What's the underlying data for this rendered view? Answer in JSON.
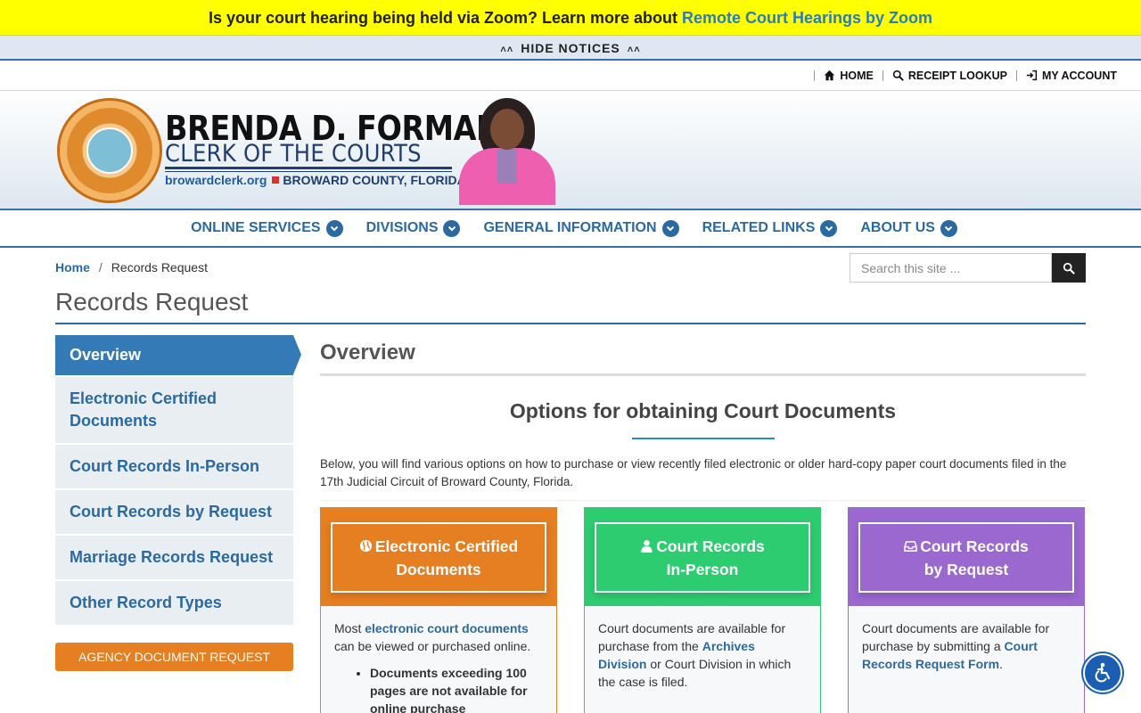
{
  "notice": {
    "text": "Is your court hearing being held via Zoom? Learn more about ",
    "link": "Remote Court Hearings by Zoom",
    "hide_label": "HIDE NOTICES"
  },
  "utility": {
    "home": "HOME",
    "receipt": "RECEIPT LOOKUP",
    "account": "MY ACCOUNT"
  },
  "brand": {
    "name": "BRENDA D. FORMAN",
    "subtitle": "CLERK OF THE COURTS",
    "site": "browardclerk.org",
    "county": "BROWARD COUNTY, FLORIDA"
  },
  "nav": [
    {
      "label": "ONLINE SERVICES"
    },
    {
      "label": "DIVISIONS"
    },
    {
      "label": "GENERAL INFORMATION"
    },
    {
      "label": "RELATED LINKS"
    },
    {
      "label": "ABOUT US"
    }
  ],
  "breadcrumb": {
    "home": "Home",
    "separator": "/",
    "current": "Records Request"
  },
  "search": {
    "placeholder": "Search this site ..."
  },
  "page_title": "Records Request",
  "sidebar": {
    "items": [
      {
        "label": "Overview"
      },
      {
        "label": "Electronic Certified Documents"
      },
      {
        "label": "Court Records In-Person"
      },
      {
        "label": "Court Records by Request"
      },
      {
        "label": "Marriage Records Request"
      },
      {
        "label": "Other Record Types"
      }
    ],
    "agency_button": "AGENCY DOCUMENT REQUEST"
  },
  "content": {
    "section_title": "Overview",
    "options_title": "Options for obtaining Court Documents",
    "intro": "Below, you will find various options on how to purchase or view recently filed electronic or older hard-copy paper court documents filed in the 17th Judicial Circuit of Broward County, Florida."
  },
  "cards": [
    {
      "line1": "Electronic Certified",
      "line2": "Documents",
      "icon": "globe-icon",
      "color": "#e67e22",
      "body_pre": "Most ",
      "body_link": "electronic court documents",
      "body_post": " can be viewed or purchased online.",
      "bullet": "Documents exceeding 100 pages are not available for online purchase"
    },
    {
      "line1": "Court Records",
      "line2": "In-Person",
      "icon": "user-icon",
      "color": "#2ecc71",
      "body_pre": "Court documents are available for purchase from the ",
      "body_link": "Archives Division",
      "body_post": " or Court Division in which the case is filed."
    },
    {
      "line1": "Court Records",
      "line2": "by Request",
      "icon": "inbox-icon",
      "color": "#9b68cf",
      "body_pre": "Court documents are available for purchase by submitting a ",
      "body_link": "Court Records Request Form",
      "body_post": "."
    }
  ]
}
